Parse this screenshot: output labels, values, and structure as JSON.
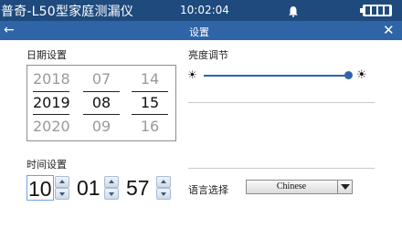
{
  "status_bar": {
    "app_title": "普奇-L50型家庭测漏仪",
    "time": "10:02:04",
    "icons": [
      "bell-icon",
      "battery-icon"
    ],
    "battery_level": 1.0
  },
  "nav_bar": {
    "back_icon": "back-arrow-icon",
    "title": "设置",
    "close_icon": "close-icon"
  },
  "date_settings": {
    "label": "日期设置",
    "year": {
      "prev": "2018",
      "selected": "2019",
      "next": "2020"
    },
    "month": {
      "prev": "07",
      "selected": "08",
      "next": "09"
    },
    "day": {
      "prev": "14",
      "selected": "15",
      "next": "16"
    }
  },
  "time_settings": {
    "label": "时间设置",
    "hour": "10",
    "minute": "01",
    "second": "57"
  },
  "brightness": {
    "label": "亮度调节",
    "min_icon": "sun-small-icon",
    "max_icon": "sun-large-icon",
    "level": 1.0
  },
  "language": {
    "label": "语言选择",
    "selected": "Chinese"
  },
  "colors": {
    "status_bar": "#1e4a7e",
    "nav_bar": "#2f64a6"
  }
}
